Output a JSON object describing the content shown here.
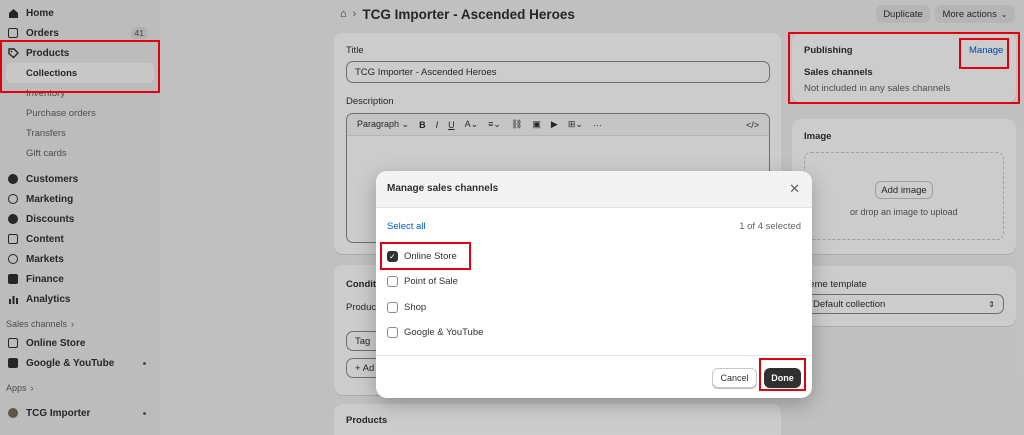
{
  "sidebar": {
    "home": "Home",
    "orders": "Orders",
    "orders_count": "41",
    "products": "Products",
    "collections": "Collections",
    "inventory": "Inventory",
    "purchase_orders": "Purchase orders",
    "transfers": "Transfers",
    "gift_cards": "Gift cards",
    "customers": "Customers",
    "marketing": "Marketing",
    "discounts": "Discounts",
    "content": "Content",
    "markets": "Markets",
    "finance": "Finance",
    "analytics": "Analytics",
    "sales_channels_label": "Sales channels",
    "online_store": "Online Store",
    "google_youtube": "Google & YouTube",
    "apps_label": "Apps",
    "tcg_importer": "TCG Importer"
  },
  "header": {
    "title": "TCG Importer - Ascended Heroes",
    "duplicate": "Duplicate",
    "more_actions": "More actions"
  },
  "main": {
    "title_label": "Title",
    "title_value": "TCG Importer - Ascended Heroes",
    "description_label": "Description",
    "paragraph": "Paragraph",
    "conditions_label": "Condit",
    "products_sub": "Produc",
    "tag_label": "Tag",
    "add_label": "+ Ad",
    "products_heading": "Products"
  },
  "publishing": {
    "heading": "Publishing",
    "manage": "Manage",
    "sales_channels": "Sales channels",
    "status": "Not included in any sales channels"
  },
  "image": {
    "heading": "Image",
    "add_image": "Add image",
    "drop_text": "or drop an image to upload"
  },
  "theme": {
    "label": "heme template",
    "value": "Default collection"
  },
  "modal": {
    "title": "Manage sales channels",
    "select_all": "Select all",
    "count": "1 of 4 selected",
    "options": [
      {
        "label": "Online Store",
        "checked": true
      },
      {
        "label": "Point of Sale",
        "checked": false
      },
      {
        "label": "Shop",
        "checked": false
      },
      {
        "label": "Google & YouTube",
        "checked": false
      }
    ],
    "cancel": "Cancel",
    "done": "Done"
  },
  "colors": {
    "accent_link": "#005bd3",
    "highlight": "#e0000f",
    "primary_button": "#303030"
  }
}
